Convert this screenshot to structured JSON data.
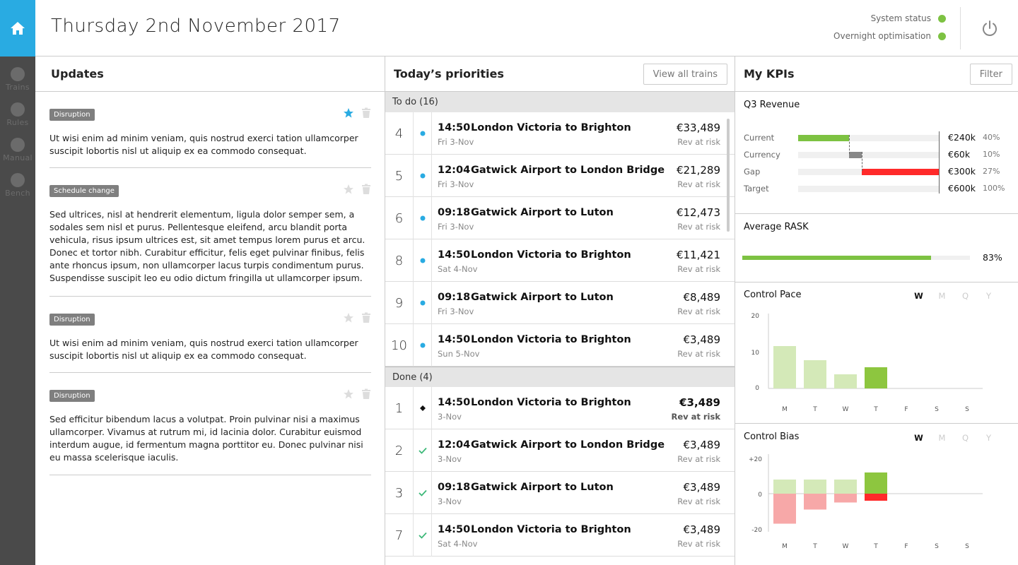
{
  "header": {
    "title": "Thursday 2nd November 2017",
    "status": [
      {
        "label": "System status",
        "color": "#7dc242"
      },
      {
        "label": "Overnight optimisation",
        "color": "#7dc242"
      }
    ]
  },
  "sidebar": {
    "items": [
      {
        "label": "Trains"
      },
      {
        "label": "Rules"
      },
      {
        "label": "Manual"
      },
      {
        "label": "Bench"
      }
    ]
  },
  "updates": {
    "title": "Updates",
    "items": [
      {
        "tag": "Disruption",
        "starred": true,
        "text": "Ut wisi enim ad minim veniam, quis nostrud exerci tation ullamcorper suscipit lobortis nisl ut aliquip ex ea commodo consequat."
      },
      {
        "tag": "Schedule change",
        "starred": false,
        "text": "Sed ultrices, nisl at hendrerit elementum, ligula dolor semper sem, a sodales sem nisl et purus. Pellentesque eleifend, arcu blandit porta vehicula, risus ipsum ultrices est, sit amet tempus lorem purus et arcu. Donec et tortor nibh. Curabitur efficitur, felis eget pulvinar finibus, felis ante rhoncus ipsum, non ullamcorper lacus turpis condimentum purus. Suspendisse suscipit leo eu odio dictum fringilla ut ullamcorper ipsum."
      },
      {
        "tag": "Disruption",
        "starred": false,
        "text": "Ut wisi enim ad minim veniam, quis nostrud exerci tation ullamcorper suscipit lobortis nisl ut aliquip ex ea commodo consequat."
      },
      {
        "tag": "Disruption",
        "starred": false,
        "text": "Sed efficitur bibendum lacus a volutpat. Proin pulvinar nisi a maximus ullamcorper. Vivamus at rutrum mi, id lacinia dolor. Curabitur euismod interdum augue, id fermentum magna porttitor eu. Donec pulvinar nisi eu massa scelerisque iaculis."
      }
    ]
  },
  "priorities": {
    "title": "Today’s priorities",
    "view_all_label": "View all trains",
    "todo_label": "To do (16)",
    "done_label": "Done (4)",
    "todo": [
      {
        "num": "4",
        "time": "14:50",
        "route": "London Victoria to Brighton",
        "date": "Fri 3-Nov",
        "amount": "€33,489",
        "risk": "Rev at risk"
      },
      {
        "num": "5",
        "time": "12:04",
        "route": "Gatwick Airport to London Bridge",
        "date": "Fri 3-Nov",
        "amount": "€21,289",
        "risk": "Rev at risk"
      },
      {
        "num": "6",
        "time": "09:18",
        "route": "Gatwick Airport to Luton",
        "date": "Fri 3-Nov",
        "amount": "€12,473",
        "risk": "Rev at risk"
      },
      {
        "num": "8",
        "time": "14:50",
        "route": "London Victoria to Brighton",
        "date": "Sat 4-Nov",
        "amount": "€11,421",
        "risk": "Rev at risk"
      },
      {
        "num": "9",
        "time": "09:18",
        "route": "Gatwick Airport to Luton",
        "date": "Fri 3-Nov",
        "amount": "€8,489",
        "risk": "Rev at risk"
      },
      {
        "num": "10",
        "time": "14:50",
        "route": "London Victoria to Brighton",
        "date": "Sun 5-Nov",
        "amount": "€3,489",
        "risk": "Rev at risk"
      }
    ],
    "done": [
      {
        "num": "1",
        "time": "14:50",
        "route": "London Victoria to Brighton",
        "date": "3-Nov",
        "amount": "€3,489",
        "risk": "Rev at risk"
      },
      {
        "num": "2",
        "time": "12:04",
        "route": "Gatwick Airport to London Bridge",
        "date": "3-Nov",
        "amount": "€3,489",
        "risk": "Rev at risk"
      },
      {
        "num": "3",
        "time": "09:18",
        "route": "Gatwick Airport to Luton",
        "date": "3-Nov",
        "amount": "€3,489",
        "risk": "Rev at risk"
      },
      {
        "num": "7",
        "time": "14:50",
        "route": "London Victoria to Brighton",
        "date": "Sat 4-Nov",
        "amount": "€3,489",
        "risk": "Rev at risk"
      }
    ]
  },
  "kpis": {
    "title": "My KPIs",
    "filter_label": "Filter",
    "q3": {
      "title": "Q3 Revenue",
      "rows": [
        {
          "label": "Current",
          "value": "€240k",
          "pct": "40%",
          "start": 0,
          "end": 0.36,
          "color": "#7dc242"
        },
        {
          "label": "Currency",
          "value": "€60k",
          "pct": "10%",
          "start": 0.36,
          "end": 0.45,
          "color": "#888888"
        },
        {
          "label": "Gap",
          "value": "€300k",
          "pct": "27%",
          "start": 0.45,
          "end": 1.0,
          "color": "#ff2a2a"
        },
        {
          "label": "Target",
          "value": "€600k",
          "pct": "100%",
          "start": 0,
          "end": 0,
          "color": "#f0f0f0"
        }
      ]
    },
    "rask": {
      "title": "Average RASK",
      "value": "83%",
      "fraction": 0.83,
      "color": "#7dc242"
    },
    "pace": {
      "title": "Control Pace",
      "tabs": [
        "W",
        "M",
        "Q",
        "Y"
      ],
      "active": "W"
    },
    "bias": {
      "title": "Control Bias",
      "tabs": [
        "W",
        "M",
        "Q",
        "Y"
      ],
      "active": "W"
    }
  },
  "chart_data": [
    {
      "type": "bar",
      "title": "Control Pace",
      "categories": [
        "M",
        "T",
        "W",
        "T",
        "F",
        "S",
        "S"
      ],
      "values": [
        12,
        8,
        4,
        6,
        null,
        null,
        null
      ],
      "yticks": [
        "20",
        "10",
        "0"
      ],
      "ylim": [
        0,
        20
      ],
      "colors": [
        "#d4e9b8",
        "#d4e9b8",
        "#d4e9b8",
        "#8dc63f"
      ]
    },
    {
      "type": "bar",
      "title": "Control Bias",
      "categories": [
        "M",
        "T",
        "W",
        "T",
        "F",
        "S",
        "S"
      ],
      "series": [
        {
          "values": [
            8,
            8,
            8,
            12,
            null,
            null,
            null
          ]
        },
        {
          "values": [
            -17,
            -9,
            -5,
            -4,
            null,
            null,
            null
          ]
        }
      ],
      "yticks": [
        "+20",
        "0",
        "-20"
      ],
      "ylim": [
        -20,
        20
      ],
      "colors_pos": [
        "#d4e9b8",
        "#d4e9b8",
        "#d4e9b8",
        "#8dc63f"
      ],
      "colors_neg": [
        "#f7a8a8",
        "#f7a8a8",
        "#f7a8a8",
        "#ff2a2a"
      ]
    }
  ]
}
